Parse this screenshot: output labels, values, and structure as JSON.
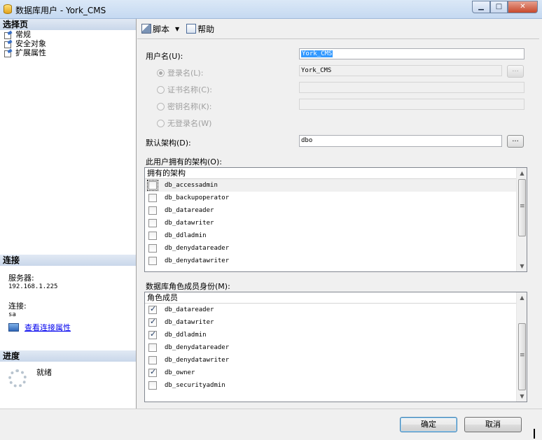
{
  "window": {
    "title": "数据库用户 - York_CMS",
    "buttons": {
      "minimize": "▁",
      "maximize": "□",
      "close": "✕"
    }
  },
  "left": {
    "select_page_header": "选择页",
    "pages": [
      {
        "label": "常规",
        "icon": "page-icon"
      },
      {
        "label": "安全对象",
        "icon": "page-icon"
      },
      {
        "label": "扩展属性",
        "icon": "page-icon"
      }
    ],
    "connection_header": "连接",
    "server_label": "服务器:",
    "server_value": "192.168.1.225",
    "connection_label": "连接:",
    "connection_value": "sa",
    "view_connection_link": "查看连接属性",
    "progress_header": "进度",
    "progress_status": "就绪"
  },
  "toolbar": {
    "script_label": "脚本",
    "help_label": "帮助"
  },
  "form": {
    "username_label": "用户名(U):",
    "username_value": "York_CMS",
    "login_name_label": "登录名(L):",
    "login_name_value": "York_CMS",
    "cert_name_label": "证书名称(C):",
    "key_name_label": "密钥名称(K):",
    "no_login_label": "无登录名(W)",
    "default_schema_label": "默认架构(D):",
    "default_schema_value": "dbo",
    "browse_label": "...",
    "owned_schemas_label": "此用户拥有的架构(O):",
    "owned_schemas_header": "拥有的架构",
    "owned_schemas": [
      {
        "name": "db_accessadmin",
        "checked": false
      },
      {
        "name": "db_backupoperator",
        "checked": false
      },
      {
        "name": "db_datareader",
        "checked": false
      },
      {
        "name": "db_datawriter",
        "checked": false
      },
      {
        "name": "db_ddladmin",
        "checked": false
      },
      {
        "name": "db_denydatareader",
        "checked": false
      },
      {
        "name": "db_denydatawriter",
        "checked": false
      }
    ],
    "role_membership_label": "数据库角色成员身份(M):",
    "role_header": "角色成员",
    "roles": [
      {
        "name": "db_datareader",
        "checked": true
      },
      {
        "name": "db_datawriter",
        "checked": true
      },
      {
        "name": "db_ddladmin",
        "checked": true
      },
      {
        "name": "db_denydatareader",
        "checked": false
      },
      {
        "name": "db_denydatawriter",
        "checked": false
      },
      {
        "name": "db_owner",
        "checked": true
      },
      {
        "name": "db_securityadmin",
        "checked": false
      }
    ]
  },
  "buttons": {
    "ok": "确定",
    "cancel": "取消"
  }
}
